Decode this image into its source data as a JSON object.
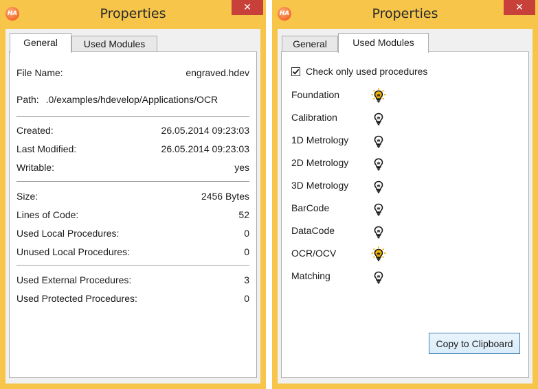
{
  "colors": {
    "frame": "#f6c54a",
    "close_button": "#c7403a",
    "client_bg": "#f0f0f0",
    "bulb_on": "#f2b705",
    "bulb_off": "#1a1a1a"
  },
  "left_window": {
    "icon_text": "HA",
    "title": "Properties",
    "close_glyph": "✕",
    "tabs": [
      {
        "label": "General",
        "active": true
      },
      {
        "label": "Used Modules",
        "active": false
      }
    ],
    "general": {
      "file_name_label": "File Name:",
      "file_name_value": "engraved.hdev",
      "path_label": "Path:",
      "path_value": ".0/examples/hdevelop/Applications/OCR",
      "created_label": "Created:",
      "created_value": "26.05.2014 09:23:03",
      "modified_label": "Last Modified:",
      "modified_value": "26.05.2014 09:23:03",
      "writable_label": "Writable:",
      "writable_value": "yes",
      "size_label": "Size:",
      "size_value": "2456 Bytes",
      "loc_label": "Lines of Code:",
      "loc_value": "52",
      "used_local_label": "Used Local Procedures:",
      "used_local_value": "0",
      "unused_local_label": "Unused Local Procedures:",
      "unused_local_value": "0",
      "used_external_label": "Used External Procedures:",
      "used_external_value": "3",
      "used_protected_label": "Used Protected Procedures:",
      "used_protected_value": "0"
    }
  },
  "right_window": {
    "icon_text": "HA",
    "title": "Properties",
    "close_glyph": "✕",
    "tabs": [
      {
        "label": "General",
        "active": false
      },
      {
        "label": "Used Modules",
        "active": true
      }
    ],
    "check_only_used": {
      "label": "Check only used procedures",
      "checked": true
    },
    "modules": [
      {
        "name": "Foundation",
        "icon": "lightbulb-on-icon",
        "active": true
      },
      {
        "name": "Calibration",
        "icon": "lightbulb-off-icon",
        "active": false
      },
      {
        "name": "1D Metrology",
        "icon": "lightbulb-off-icon",
        "active": false
      },
      {
        "name": "2D Metrology",
        "icon": "lightbulb-off-icon",
        "active": false
      },
      {
        "name": "3D Metrology",
        "icon": "lightbulb-off-icon",
        "active": false
      },
      {
        "name": "BarCode",
        "icon": "lightbulb-off-icon",
        "active": false
      },
      {
        "name": "DataCode",
        "icon": "lightbulb-off-icon",
        "active": false
      },
      {
        "name": "OCR/OCV",
        "icon": "lightbulb-on-icon",
        "active": true
      },
      {
        "name": "Matching",
        "icon": "lightbulb-off-icon",
        "active": false
      }
    ],
    "copy_button_label": "Copy to Clipboard"
  }
}
